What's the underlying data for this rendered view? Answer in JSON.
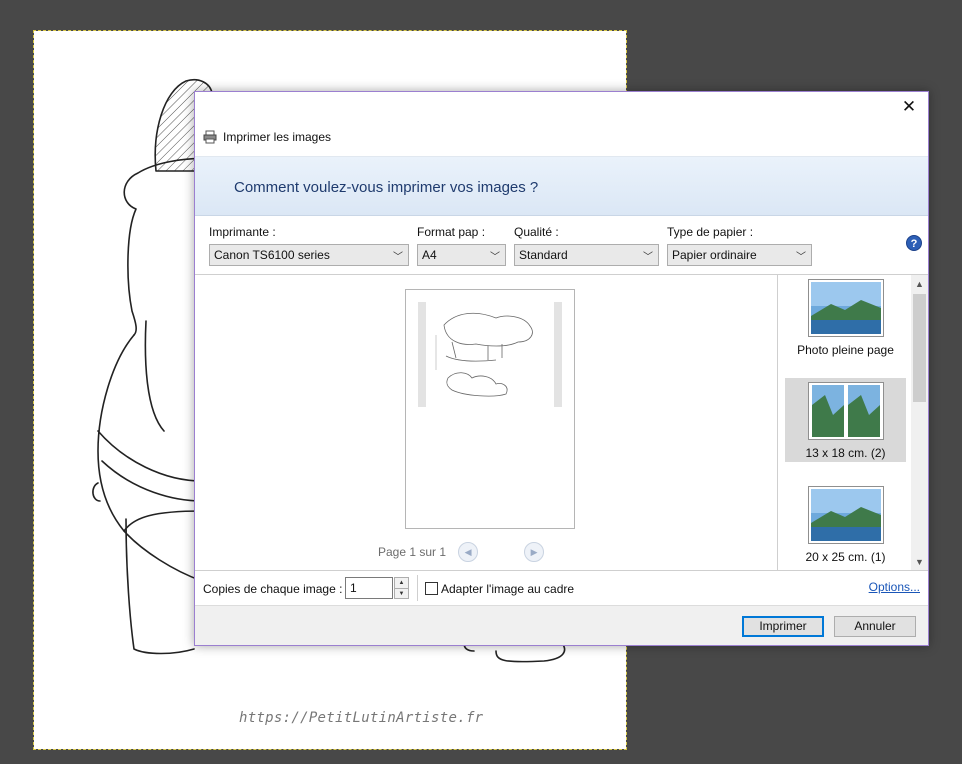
{
  "background": {
    "watermark": "https://PetitLutinArtiste.fr"
  },
  "dialog": {
    "title": "Imprimer les images",
    "question": "Comment voulez-vous imprimer vos images ?",
    "close_glyph": "✕",
    "printer": {
      "label": "Imprimante :",
      "value": "Canon TS6100 series"
    },
    "paper_size": {
      "label": "Format pap :",
      "value": "A4"
    },
    "quality": {
      "label": "Qualité :",
      "value": "Standard"
    },
    "paper_type": {
      "label": "Type de papier :",
      "value": "Papier ordinaire"
    },
    "help_glyph": "?",
    "preview": {
      "page_indicator": "Page 1 sur 1",
      "prev_glyph": "◀",
      "next_glyph": "▶"
    },
    "layouts": [
      {
        "label": "Photo pleine page",
        "selected": false
      },
      {
        "label": "13 x 18 cm. (2)",
        "selected": true
      },
      {
        "label": "20 x 25 cm. (1)",
        "selected": false
      }
    ],
    "copies": {
      "label": "Copies de chaque image :",
      "value": "1"
    },
    "fit_to_frame": {
      "label": "Adapter l'image au cadre",
      "checked": false
    },
    "options_link": "Options...",
    "buttons": {
      "print": "Imprimer",
      "cancel": "Annuler"
    }
  }
}
